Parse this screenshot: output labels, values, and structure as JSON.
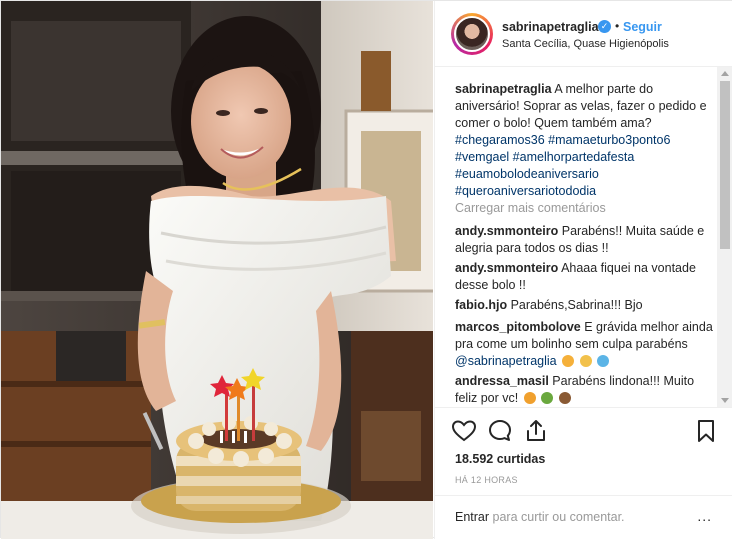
{
  "post": {
    "username": "sabrinapetraglia",
    "follow_label": "Seguir",
    "separator": "•",
    "location": "Santa Cecília, Quase Higienópolis",
    "verified_icon": "verified-badge-icon"
  },
  "caption": {
    "username": "sabrinapetraglia",
    "text": "A melhor parte do aniversário! Soprar as velas, fazer o pedido e comer o bolo! Quem também ama?",
    "hashtags": [
      "#chegaramos36 #mamaeturbo3ponto6",
      "#vemgael #amelhorpartedafesta",
      "#euamobolodeaniversario",
      "#queroaniversariotododia"
    ]
  },
  "load_more_label": "Carregar mais comentários",
  "comments": [
    {
      "username": "andy.smmonteiro",
      "text": "Parabéns!! Muita saúde e alegria para todos os dias !!"
    },
    {
      "username": "andy.smmonteiro",
      "text": "Ahaaa fiquei na vontade desse bolo !!"
    },
    {
      "username": "fabio.hjo",
      "text": "Parabéns,Sabrina!!! Bjo"
    },
    {
      "username": "marcos_pitombolove",
      "text": "E grávida melhor ainda pra come um bolinho sem culpa parabéns",
      "mention": "@sabrinapetraglia"
    },
    {
      "username": "andressa_masil",
      "text": "Parabéns lindona!!! Muito feliz por vc!"
    }
  ],
  "actions": {
    "likes": "18.592 curtidas",
    "time": "HÁ 12 HORAS"
  },
  "comment_bar": {
    "link": "Entrar",
    "rest": " para curtir ou comentar.",
    "more": "..."
  },
  "colors": {
    "link_blue": "#3897f0",
    "hashtag": "#003569",
    "muted": "#999999",
    "text": "#262626"
  }
}
